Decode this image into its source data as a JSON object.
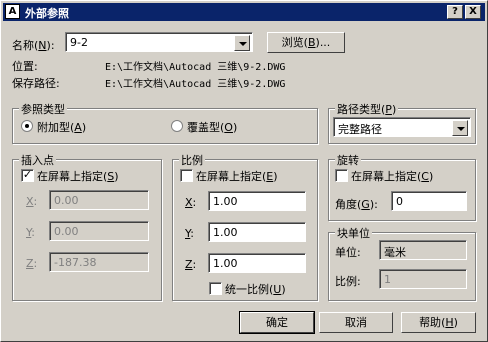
{
  "window": {
    "title": "外部参照",
    "help_btn": "?",
    "close_btn": "X",
    "app_icon": "A"
  },
  "name": {
    "label": "名称",
    "key": "N",
    "value": "9-2",
    "browse_label": "浏览",
    "browse_key": "B",
    "browse_suffix": "..."
  },
  "location": {
    "label": "位置:",
    "value": "E:\\工作文档\\Autocad 三维\\9-2.DWG"
  },
  "saved_path": {
    "label": "保存路径:",
    "value": "E:\\工作文档\\Autocad 三维\\9-2.DWG"
  },
  "reference_type": {
    "title": "参照类型",
    "attach": {
      "label": "附加型",
      "key": "A",
      "checked": true
    },
    "overlay": {
      "label": "覆盖型",
      "key": "O",
      "checked": false
    }
  },
  "path_type": {
    "title": "路径类型",
    "key": "P",
    "value": "完整路径"
  },
  "insertion": {
    "title": "插入点",
    "specify_label": "在屏幕上指定",
    "specify_key": "S",
    "checked": true,
    "x": {
      "key": "X",
      "value": "0.00"
    },
    "y": {
      "key": "Y",
      "value": "0.00"
    },
    "z": {
      "key": "Z",
      "value": "-187.38"
    }
  },
  "scale": {
    "title": "比例",
    "specify_label": "在屏幕上指定",
    "specify_key": "E",
    "checked": false,
    "x": {
      "key": "X",
      "value": "1.00"
    },
    "y": {
      "key": "Y",
      "value": "1.00"
    },
    "z": {
      "key": "Z",
      "value": "1.00"
    },
    "uniform_label": "统一比例",
    "uniform_key": "U",
    "uniform_checked": false
  },
  "rotation": {
    "title": "旋转",
    "specify_label": "在屏幕上指定",
    "specify_key": "C",
    "checked": false,
    "angle_label": "角度",
    "angle_key": "G",
    "angle_value": "0"
  },
  "block_unit": {
    "title": "块单位",
    "unit_label": "单位:",
    "unit_value": "毫米",
    "scale_label": "比例:",
    "scale_value": "1"
  },
  "buttons": {
    "ok": "确定",
    "cancel": "取消",
    "help": "帮助",
    "help_key": "H"
  },
  "icons": [
    "autocad-app-icon",
    "help-icon",
    "close-icon",
    "dropdown-arrow-icon",
    "checkmark-icon",
    "radio-icon"
  ]
}
